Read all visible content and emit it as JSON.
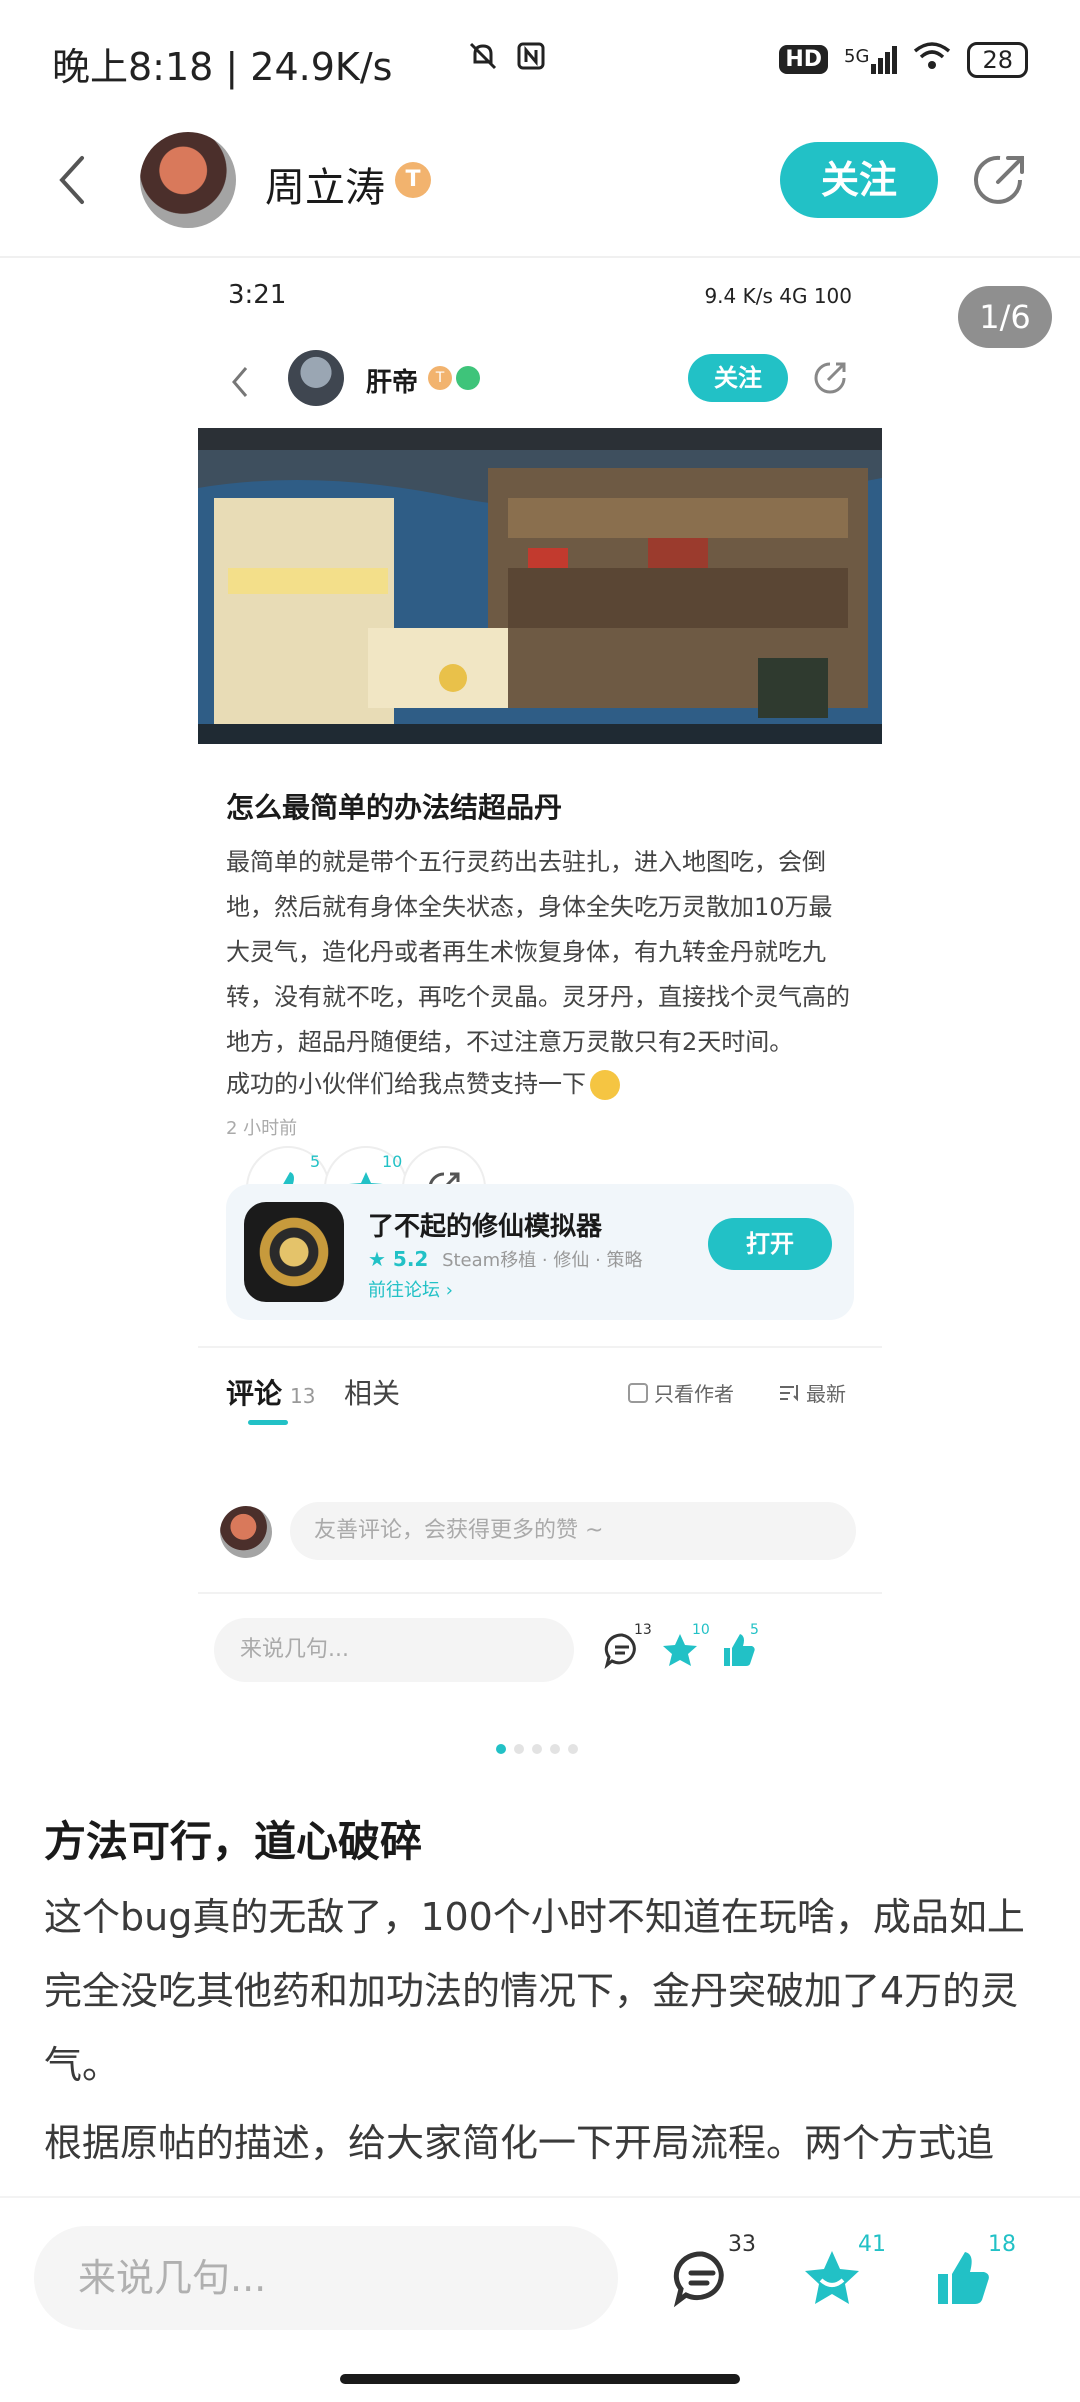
{
  "status_bar": {
    "time": "晚上8:18 | 24.9K/s",
    "network": "5G",
    "hd": "HD",
    "battery": "28"
  },
  "header": {
    "author_name": "周立涛",
    "badge": "T",
    "follow_label": "关注"
  },
  "gallery": {
    "page_indicator": "1/6",
    "pages_total": 5,
    "active_page": 1
  },
  "screenshot": {
    "status_time": "3:21",
    "status_right": "9.4 K/s  4G  100",
    "author_name": "肝帝",
    "badge": "T",
    "follow_label": "关注",
    "title": "怎么最简单的办法结超品丹",
    "body": "最简单的就是带个五行灵药出去驻扎，进入地图吃，会倒地，然后就有身体全失状态，身体全失吃万灵散加10万最大灵气，造化丹或者再生术恢复身体，有九转金丹就吃九转，没有就不吃，再吃个灵晶。灵牙丹，直接找个灵气高的地方，超品丹随便结，不过注意万灵散只有2天时间。",
    "support_text": "成功的小伙伴们给我点赞支持一下",
    "time_ago": "2 小时前",
    "like_count": "5",
    "star_count": "10",
    "game": {
      "name": "了不起的修仙模拟器",
      "rating": "5.2",
      "tags": "Steam移植 · 修仙 · 策略",
      "forum_link": "前往论坛",
      "open_label": "打开"
    },
    "tabs": {
      "comment_label": "评论",
      "comment_count": "13",
      "related_label": "相关"
    },
    "only_author_label": "只看作者",
    "sort_label": "最新",
    "comment_placeholder": "友善评论，会获得更多的赞 ~",
    "bottom_placeholder": "来说几句...",
    "bottom_comment_count": "13",
    "bottom_star_count": "10",
    "bottom_like_count": "5"
  },
  "post": {
    "title": "方法可行，道心破碎",
    "paragraph1": "这个bug真的无敌了，100个小时不知道在玩啥，成品如上完全没吃其他药和加功法的情况下，金丹突破加了4万的灵气。",
    "paragraph2": "根据原帖的描述，给大家简化一下开局流程。两个方式追"
  },
  "bottom_bar": {
    "placeholder": "来说几句...",
    "comment_count": "33",
    "star_count": "41",
    "like_count": "18"
  },
  "colors": {
    "accent": "#22c1c6",
    "badge": "#f2b36e"
  }
}
